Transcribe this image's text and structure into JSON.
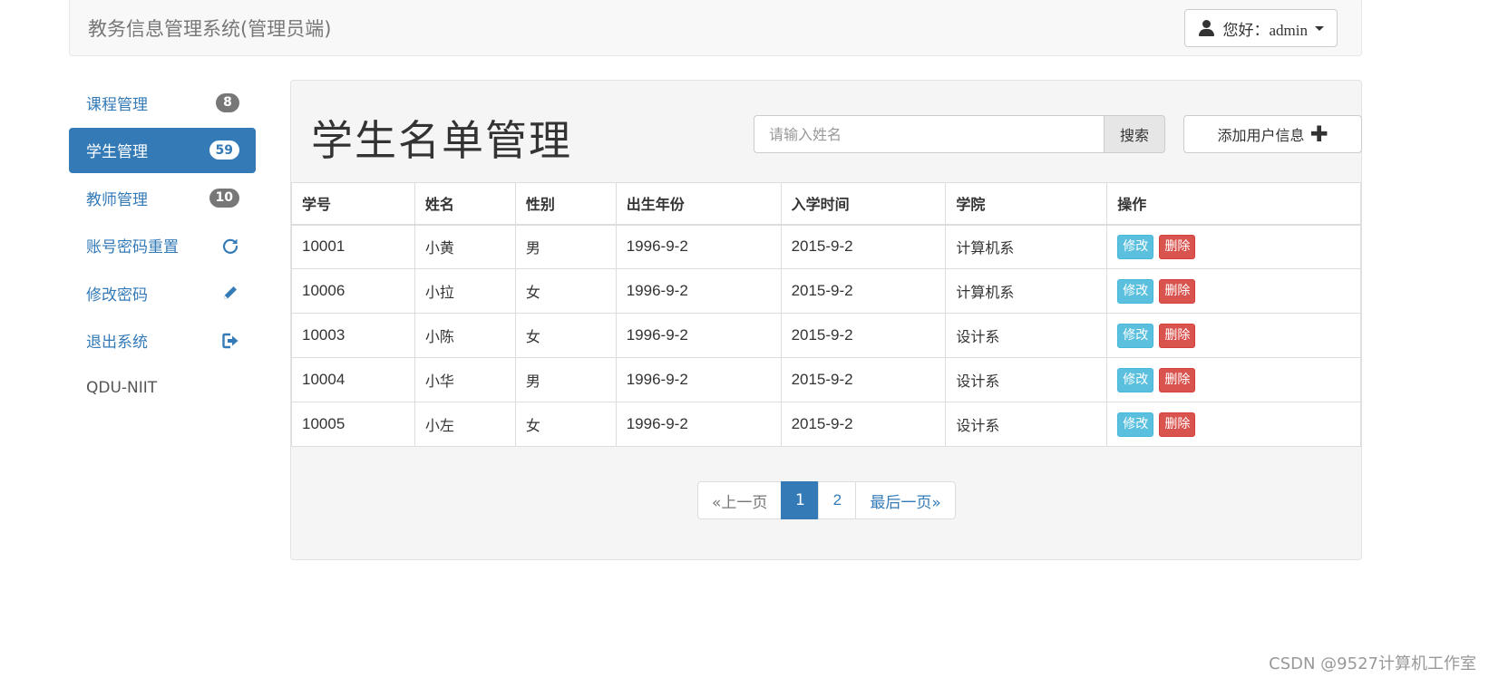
{
  "header": {
    "brand": "教务信息管理系统(管理员端)",
    "user_label": "您好：admin"
  },
  "sidebar": {
    "items": [
      {
        "label": "课程管理",
        "badge": "8"
      },
      {
        "label": "学生管理",
        "badge": "59"
      },
      {
        "label": "教师管理",
        "badge": "10"
      },
      {
        "label": "账号密码重置",
        "icon": "refresh-icon"
      },
      {
        "label": "修改密码",
        "icon": "pencil-icon"
      },
      {
        "label": "退出系统",
        "icon": "logout-icon"
      }
    ],
    "footer": "QDU-NIIT"
  },
  "main": {
    "title": "学生名单管理",
    "search": {
      "placeholder": "请输入姓名",
      "button": "搜索"
    },
    "add_button": "添加用户信息",
    "table": {
      "headers": [
        "学号",
        "姓名",
        "性别",
        "出生年份",
        "入学时间",
        "学院",
        "操作"
      ],
      "rows": [
        [
          "10001",
          "小黄",
          "男",
          "1996-9-2",
          "2015-9-2",
          "计算机系"
        ],
        [
          "10006",
          "小拉",
          "女",
          "1996-9-2",
          "2015-9-2",
          "计算机系"
        ],
        [
          "10003",
          "小陈",
          "女",
          "1996-9-2",
          "2015-9-2",
          "设计系"
        ],
        [
          "10004",
          "小华",
          "男",
          "1996-9-2",
          "2015-9-2",
          "设计系"
        ],
        [
          "10005",
          "小左",
          "女",
          "1996-9-2",
          "2015-9-2",
          "设计系"
        ]
      ],
      "edit_label": "修改",
      "delete_label": "删除"
    },
    "pagination": {
      "prev": "«上一页",
      "pages": [
        "1",
        "2"
      ],
      "active": "1",
      "last": "最后一页»"
    }
  },
  "watermark": "CSDN @9527计算机工作室",
  "colors": {
    "primary": "#337ab7",
    "info": "#5bc0de",
    "danger": "#d9534f"
  }
}
